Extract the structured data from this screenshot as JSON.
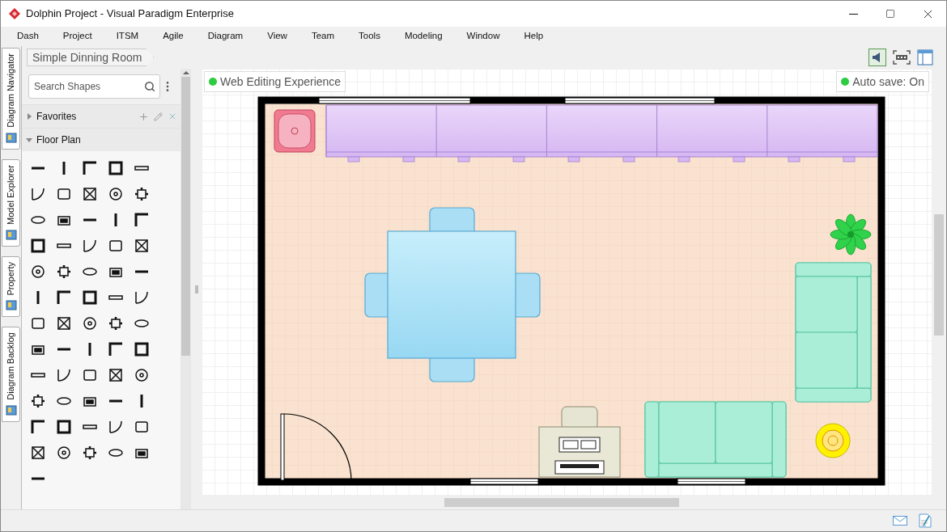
{
  "window": {
    "title": "Dolphin Project - Visual Paradigm Enterprise"
  },
  "menu": [
    "Dash",
    "Project",
    "ITSM",
    "Agile",
    "Diagram",
    "View",
    "Team",
    "Tools",
    "Modeling",
    "Window",
    "Help"
  ],
  "side_tabs": [
    {
      "label": "Diagram Navigator",
      "selected": false
    },
    {
      "label": "Model Explorer",
      "selected": false
    },
    {
      "label": "Property",
      "selected": false
    },
    {
      "label": "Diagram Backlog",
      "selected": false
    }
  ],
  "breadcrumb": "Simple Dinning Room",
  "search": {
    "placeholder": "Search Shapes"
  },
  "sections": [
    {
      "label": "Favorites",
      "expanded": false
    },
    {
      "label": "Floor Plan",
      "expanded": true
    }
  ],
  "canvas": {
    "left_badge": "Web Editing Experience",
    "right_badge": "Auto save: On"
  }
}
